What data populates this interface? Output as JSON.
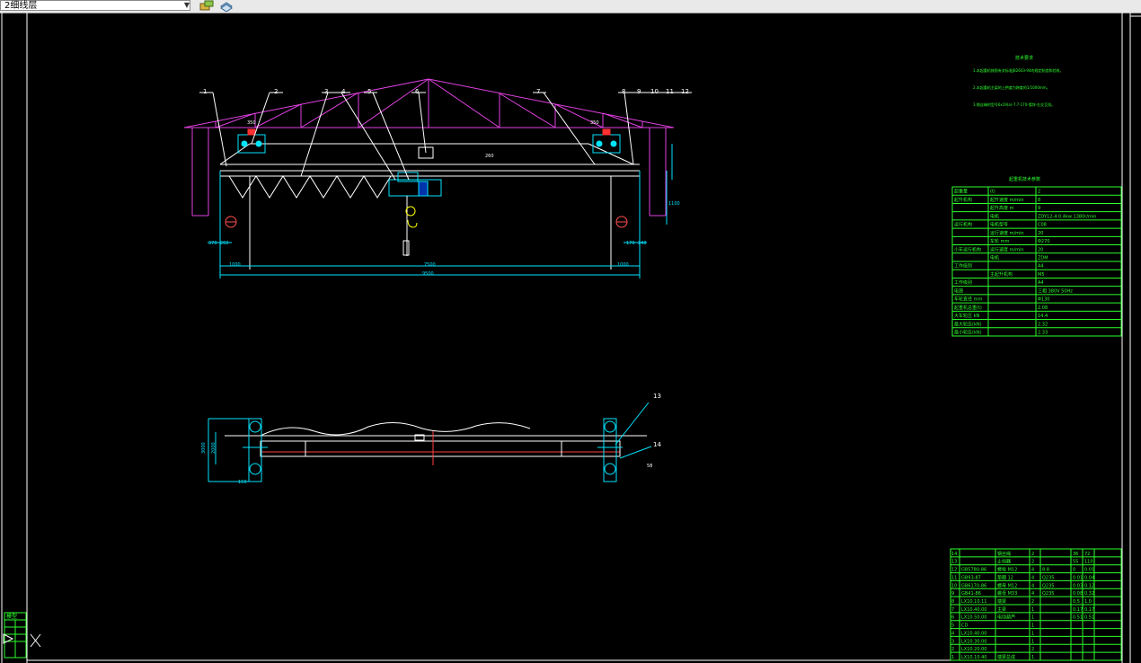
{
  "toolbar": {
    "layer_name": "2细线层",
    "icons": [
      "layer-state-icon",
      "layer-tools-icon"
    ]
  },
  "notes": {
    "title": "技术要求",
    "items": [
      "1.本起重机按照有关标准JB2603-94的规定制造和验收。",
      "2.本起重机主梁的上拱度为跨度的1/1000mm。",
      "3.钢丝绳的型号6x19(a)-7.7-170-镀锌-右交互捻。"
    ]
  },
  "drawing": {
    "callouts": [
      "1",
      "2",
      "3",
      "4",
      "5",
      "6",
      "7",
      "8",
      "9",
      "10",
      "11",
      "12",
      "13",
      "14"
    ],
    "dims": {
      "d1": "1000",
      "d2": "7500",
      "d3": "1000",
      "d4": "9500",
      "d5": "1000",
      "d6": "370",
      "d7": "202",
      "d8": "170",
      "d9": "248",
      "d10": "260",
      "d11": "350",
      "d12": "350",
      "d13": "3000",
      "d14": "2000",
      "d15": "150",
      "d16": "1100",
      "d17": "58"
    }
  },
  "spec_table": {
    "title": "起重机技术参数",
    "rows": [
      [
        "起重量",
        "(t)",
        "2"
      ],
      [
        "起升机构",
        "起升速度 m/min",
        "8"
      ],
      [
        "",
        "起升高度 m",
        "9"
      ],
      [
        "",
        "电机",
        "ZDY12-4 0.4kw 1380r/min"
      ],
      [
        "运行机构",
        "电机型号",
        "C08"
      ],
      [
        "",
        "运行速度 m/min",
        "20"
      ],
      [
        "",
        "车轮 mm",
        "Φ270"
      ],
      [
        "小车运行机构",
        "运行速度 m/min",
        "20"
      ],
      [
        "",
        "电机",
        "ZDM"
      ],
      [
        "工作级别",
        "",
        "A4"
      ],
      [
        "",
        "主起升机构",
        "M5"
      ],
      [
        "工作级别",
        "",
        "A4"
      ],
      [
        "电源",
        "",
        "三相 380V 50Hz"
      ],
      [
        "车轮直径 mm",
        "",
        "Φ130"
      ],
      [
        "起重机总重(t)",
        "",
        "2.08"
      ],
      [
        "大车轮压 kN",
        "",
        "14.4"
      ],
      [
        "最大轮压(kN)",
        "",
        "2.32"
      ],
      [
        "最小轮压(kN)",
        "",
        "2.33"
      ]
    ]
  },
  "parts_table": {
    "rows": [
      [
        "14",
        "",
        "钢丝绳",
        "2",
        "",
        "36",
        "72",
        ""
      ],
      [
        "13",
        "",
        "止挡器",
        "2",
        "",
        "55",
        "110",
        ""
      ],
      [
        "12",
        "GB5780-86",
        "螺栓 M12",
        "4",
        "8.8",
        "0",
        "0.01",
        ""
      ],
      [
        "11",
        "GB93-87",
        "垫圈 12",
        "4",
        "Q235",
        "0.01",
        "0.04",
        ""
      ],
      [
        "10",
        "GB6170-86",
        "螺母 M12",
        "4",
        "Q235",
        "0.03",
        "0.12",
        ""
      ],
      [
        "9",
        "GB41-86",
        "螺母 M33",
        "4",
        "Q235",
        "0.08",
        "0.32",
        ""
      ],
      [
        "8",
        "LX10.10.11",
        "端梁",
        "2",
        "",
        "0.5",
        "1.0",
        ""
      ],
      [
        "7",
        "LX10.40.00",
        "主梁",
        "1",
        "",
        "0.17",
        "0.17",
        ""
      ],
      [
        "6",
        "LX10.50.00",
        "电动葫芦",
        "1",
        "",
        "0.51",
        "0.51",
        ""
      ],
      [
        "5",
        "CD",
        "",
        "1",
        "",
        "",
        "",
        ""
      ],
      [
        "4",
        "LX10.40.00",
        "",
        "1",
        "",
        "",
        "",
        ""
      ],
      [
        "3",
        "LX10.30.00",
        "",
        "1",
        "",
        "",
        "",
        ""
      ],
      [
        "2",
        "LX10.20.00",
        "",
        "2",
        "",
        "",
        "",
        ""
      ],
      [
        "1",
        "LX10.10.40",
        "端梁总成",
        "1",
        "",
        "",
        "",
        ""
      ]
    ]
  },
  "left_panel": {
    "label": "模型"
  }
}
